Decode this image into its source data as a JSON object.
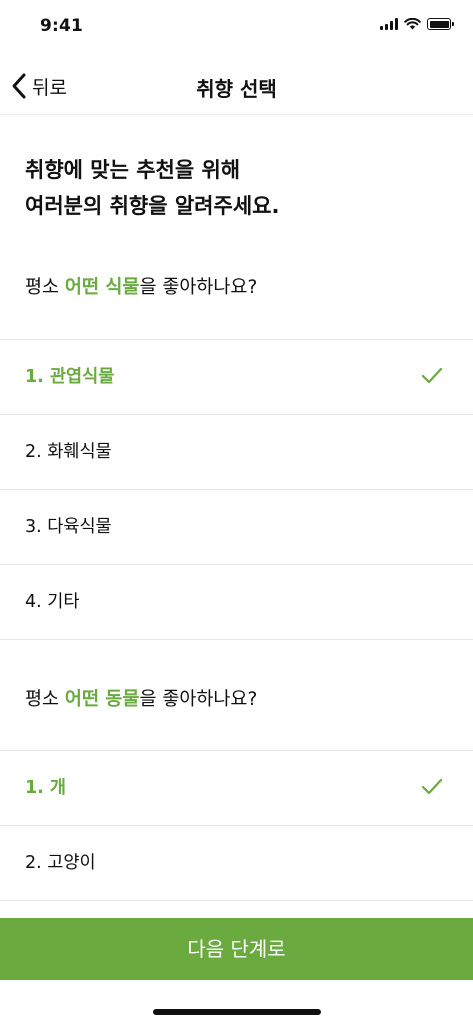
{
  "status": {
    "time": "9:41"
  },
  "nav": {
    "back_label": "뒤로",
    "title": "취향 선택"
  },
  "headline": {
    "line1": "취향에 맞는 추천을 위해",
    "line2": "여러분의 취향을 알려주세요."
  },
  "q1": {
    "prefix": "평소 ",
    "highlight": "어떤 식물",
    "suffix": "을 좋아하나요?"
  },
  "q1_options": [
    {
      "label": "1. 관엽식물",
      "selected": true
    },
    {
      "label": "2. 화훼식물",
      "selected": false
    },
    {
      "label": "3. 다육식물",
      "selected": false
    },
    {
      "label": "4. 기타",
      "selected": false
    }
  ],
  "q2": {
    "prefix": "평소 ",
    "highlight": "어떤 동물",
    "suffix": "을 좋아하나요?"
  },
  "q2_options": [
    {
      "label": "1. 개",
      "selected": true
    },
    {
      "label": "2. 고양이",
      "selected": false
    }
  ],
  "next_button": "다음 단계로",
  "colors": {
    "accent": "#6aaa3f",
    "text": "#111111",
    "divider": "#e6e6e6"
  }
}
